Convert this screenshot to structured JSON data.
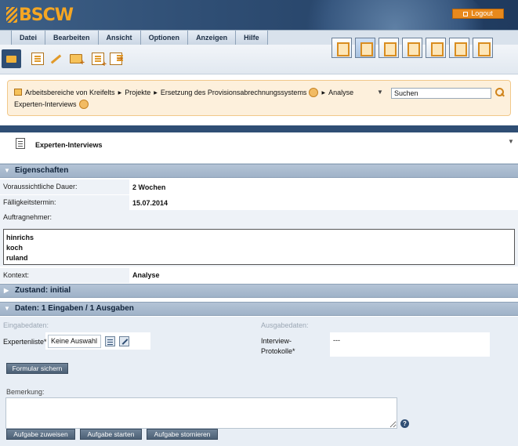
{
  "app": {
    "logo_text": "BSCW",
    "logout_label": "Logout"
  },
  "menu": {
    "items": [
      "Datei",
      "Bearbeiten",
      "Ansicht",
      "Optionen",
      "Anzeigen",
      "Hilfe"
    ]
  },
  "breadcrumb": {
    "items": [
      "Arbeitsbereiche von Kreifelts",
      "Projekte",
      "Ersetzung des Provisionsabrechnungssystems",
      "Analyse",
      "Experten-Interviews"
    ]
  },
  "search": {
    "value": "Suchen"
  },
  "page": {
    "title": "Experten-Interviews"
  },
  "properties": {
    "header": "Eigenschaften",
    "duration_label": "Voraussichtliche Dauer:",
    "duration_value": "2 Wochen",
    "due_label": "Fälligkeitstermin:",
    "due_value": "15.07.2014",
    "assignees_label": "Auftragnehmer:",
    "assignees": [
      "hinrichs",
      "koch",
      "ruland"
    ],
    "context_label": "Kontext:",
    "context_value": "Analyse"
  },
  "state": {
    "header": "Zustand: initial"
  },
  "data_section": {
    "header": "Daten: 1 Eingaben / 1 Ausgaben",
    "inputs_label": "Eingabedaten:",
    "outputs_label": "Ausgabedaten:",
    "expert_list_label": "Expertenliste*",
    "expert_list_value": "Keine Auswahl",
    "protocols_label_1": "Interview-",
    "protocols_label_2": "Protokolle*",
    "protocols_value": "---",
    "save_form_label": "Formular sichern",
    "remark_label": "Bemerkung:",
    "assign_label": "Aufgabe zuweisen",
    "start_label": "Aufgabe starten",
    "cancel_label": "Aufgabe stornieren",
    "help_symbol": "?"
  }
}
